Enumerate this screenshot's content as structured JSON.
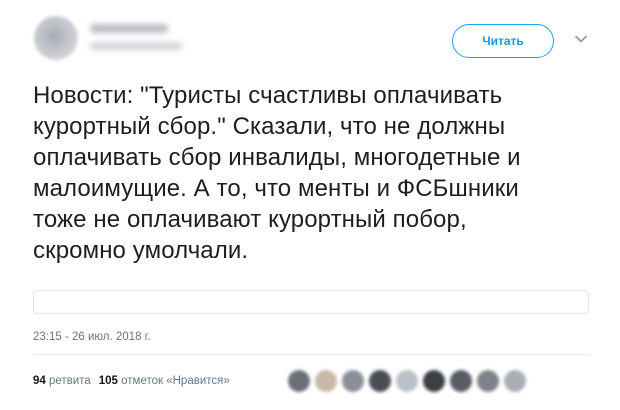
{
  "header": {
    "follow_label": "Читать"
  },
  "tweet": {
    "text_lines": [
      "Новости: \"Туристы счастливы оплачивать",
      "курортный сбор.\" Сказали, что  не должны",
      "оплачивать сбор инвалиды, многодетные и",
      "малоимущие.  А то, что менты и ФСБшники",
      "тоже не оплачивают курортный побор,",
      "скромно умолчали."
    ],
    "timestamp": "23:15 - 26 июл. 2018 г."
  },
  "stats": {
    "retweets_count": "94",
    "retweets_label": "ретвита",
    "likes_count": "105",
    "likes_label": "отметок «Нравится»"
  },
  "likers": [
    {
      "color": "#6b6f76"
    },
    {
      "color": "#c9b8a8"
    },
    {
      "color": "#8a8f99"
    },
    {
      "color": "#4a4d52"
    },
    {
      "color": "#b9c0c8"
    },
    {
      "color": "#3c3f44"
    },
    {
      "color": "#585c63"
    },
    {
      "color": "#7d8289"
    },
    {
      "color": "#a9aeb5"
    }
  ],
  "colors": {
    "accent": "#1da1f2",
    "muted_text": "#657786"
  }
}
